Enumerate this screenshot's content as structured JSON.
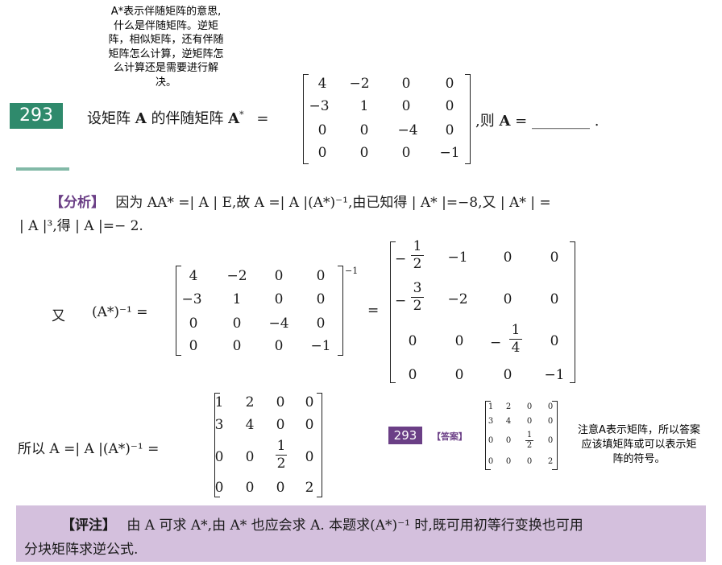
{
  "top_note": [
    "A*表示伴随矩阵的意思,",
    "什么是伴随矩阵。逆矩",
    "阵，相似矩阵，还有伴随",
    "矩阵怎么计算，逆矩阵怎",
    "么计算还是需要进行解",
    "决。"
  ],
  "problem": {
    "number": "293",
    "text_before": "设矩阵",
    "var_a": "A",
    "text_mid": "的伴随矩阵",
    "var_astar": "A",
    "star": "*",
    "equals": "=",
    "text_after": ",则",
    "var_a2": "A",
    "equals2": "=",
    "blank": "________",
    "period": ".",
    "matrix": [
      [
        "4",
        "−2",
        "0",
        "0"
      ],
      [
        "−3",
        "1",
        "0",
        "0"
      ],
      [
        "0",
        "0",
        "−4",
        "0"
      ],
      [
        "0",
        "0",
        "0",
        "−1"
      ]
    ]
  },
  "analysis": {
    "tag": "【分析】",
    "line1": "因为 AA* =| A | E,故 A =| A |(A*)⁻¹,由已知得 | A* |=−8,又 | A* | =",
    "line2": "| A |³,得 | A |=− 2.",
    "you": "又",
    "inv_label": "(A*)⁻¹ =",
    "inv_exp": "−1",
    "eq": "=",
    "result": {
      "row1": [
        "−",
        "1",
        "2",
        "−1",
        "0",
        "0"
      ],
      "row2": [
        "−",
        "3",
        "2",
        "−2",
        "0",
        "0"
      ],
      "row3": [
        "0",
        "0",
        "−",
        "1",
        "4",
        "0"
      ],
      "row4": [
        "0",
        "0",
        "0",
        "−1"
      ]
    },
    "so_label": "所以 A =| A |(A*)⁻¹ =",
    "final": [
      [
        "1",
        "2",
        "0",
        "0"
      ],
      [
        "3",
        "4",
        "0",
        "0"
      ],
      [
        "0",
        "0",
        "1",
        "2",
        "0"
      ],
      [
        "0",
        "0",
        "0",
        "2"
      ]
    ]
  },
  "answer": {
    "number": "293",
    "tag": "【答案】",
    "matrix": [
      [
        "1",
        "2",
        "0",
        "0"
      ],
      [
        "3",
        "4",
        "0",
        "0"
      ],
      [
        "0",
        "0",
        "1",
        "2",
        "0"
      ],
      [
        "0",
        "0",
        "0",
        "2"
      ]
    ]
  },
  "side_note": [
    "注意A表示矩阵，所以答案",
    "应该填矩阵或可以表示矩",
    "阵的符号。"
  ],
  "review": {
    "tag": "【评注】",
    "line1": "由 A 可求 A*,由 A* 也应会求 A. 本题求(A*)⁻¹ 时,既可用初等行变换也可用",
    "line2": "分块矩阵求逆公式."
  },
  "colors": {
    "badge_green": "#2f8a6c",
    "purple": "#6b3f86",
    "review_bg": "#d4c0dd"
  }
}
